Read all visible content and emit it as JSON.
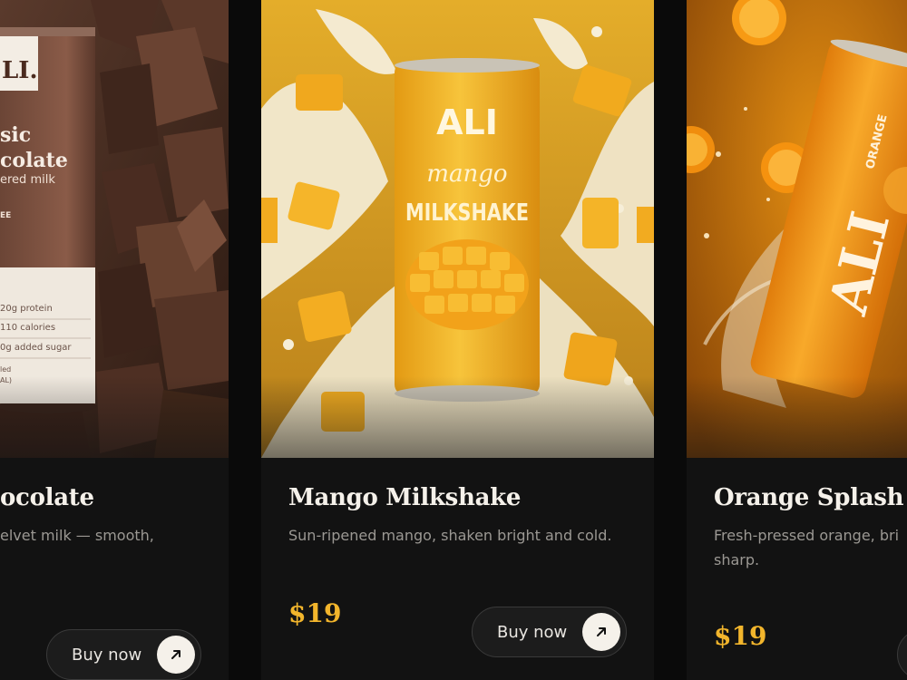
{
  "cards": [
    {
      "title": "ocolate",
      "description": "elvet milk — smooth,",
      "buy_label": "Buy now",
      "can_brand": "LI.",
      "can_line1": "sic",
      "can_line2": "colate",
      "can_line3": "ered milk",
      "can_tag": "EE",
      "can_fact1": "20g protein",
      "can_fact2": "110 calories",
      "can_fact3": "0g added sugar",
      "can_fact4": "led",
      "can_fact5": "AL)"
    },
    {
      "title": "Mango Milkshake",
      "description": "Sun-ripened mango, shaken bright and cold.",
      "price": "$19",
      "buy_label": "Buy now",
      "can_brand": "ALI",
      "can_line1": "mango",
      "can_line2": "MILKSHAKE"
    },
    {
      "title": "Orange Splash",
      "description_line1": "Fresh-pressed orange, bri",
      "description_line2": "sharp.",
      "price": "$19",
      "can_brand": "ALI",
      "can_flavor": "ORANGE"
    }
  ],
  "colors": {
    "page_bg": "#0a0a0a",
    "card_bg": "#121212",
    "price": "#f2b52c",
    "title": "#f5f1ea",
    "description": "#9b9893"
  },
  "icons": [
    "arrow-up-right-icon"
  ]
}
